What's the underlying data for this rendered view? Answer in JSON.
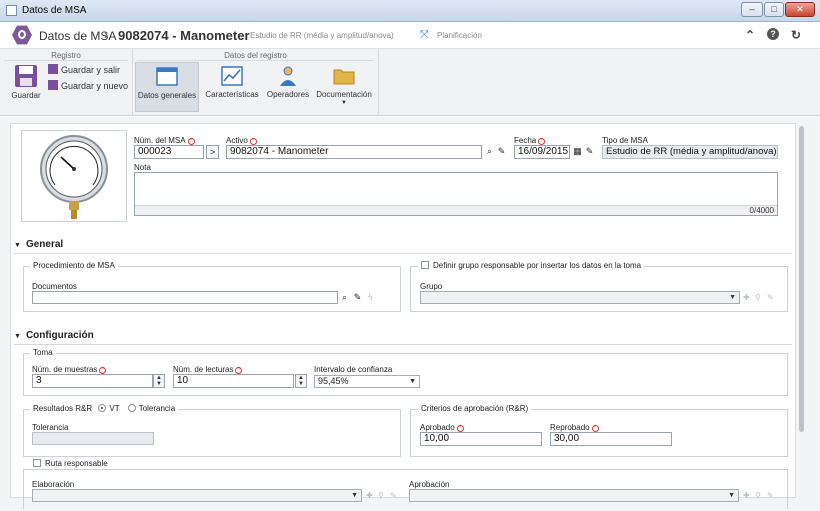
{
  "window": {
    "title": "Datos de MSA",
    "controls": {
      "minimize": "–",
      "maximize": "□",
      "close": "✕"
    }
  },
  "header": {
    "app": "Datos de MSA",
    "separator": "›",
    "record": "9082074 - Manometer",
    "subtitle": "Estudio de RR (média y amplitud/anova)",
    "planning": "Planificación",
    "icons": [
      "collapse-icon",
      "help-icon",
      "refresh-icon"
    ]
  },
  "ribbon": {
    "groups": {
      "registro": "Registro",
      "datos_registro": "Datos del registro"
    },
    "save": "Guardar",
    "save_exit": "Guardar y salir",
    "save_new": "Guardar y nuevo",
    "tabs": [
      "Datos generales",
      "Características",
      "Operadores",
      "Documentación"
    ],
    "active_tab": "Datos generales"
  },
  "record": {
    "num_label": "Núm. del MSA",
    "num_value": "000023",
    "asset_label": "Activo",
    "asset_value": "9082074 - Manometer",
    "date_label": "Fecha",
    "date_value": "16/09/2015",
    "type_label": "Tipo de MSA",
    "type_value": "Estudio de RR (média y amplitud/anova)",
    "note_label": "Nota",
    "note_value": "",
    "note_counter": "0/4000"
  },
  "general": {
    "title": "General",
    "procedure_legend": "Procedimiento de MSA",
    "documents_label": "Documentos",
    "documents_value": "",
    "define_group_label": "Definir grupo responsable por insertar los datos en la toma",
    "group_label": "Grupo",
    "group_value": ""
  },
  "config": {
    "title": "Configuración",
    "toma_legend": "Toma",
    "samples_label": "Núm. de muestras",
    "samples_value": "3",
    "readings_label": "Núm. de lecturas",
    "readings_value": "10",
    "confidence_label": "Intervalo de confianza",
    "confidence_value": "95,45%",
    "rr_legend": "Resultados R&R",
    "rr_options": [
      "VT",
      "Tolerancia"
    ],
    "rr_selected": "VT",
    "tolerance_label": "Tolerancia",
    "tolerance_value": "",
    "criteria_legend": "Criterios de aprobación (R&R)",
    "approved_label": "Aprobado",
    "approved_value": "10,00",
    "rejected_label": "Reprobado",
    "rejected_value": "30,00",
    "route_label": "Ruta responsable",
    "elaboration_label": "Elaboración",
    "approval_label": "Aprobación"
  }
}
